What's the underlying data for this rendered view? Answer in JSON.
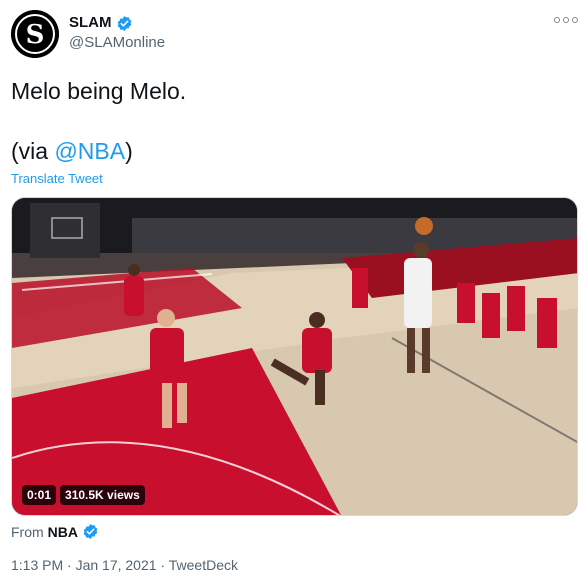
{
  "author": {
    "name": "SLAM",
    "handle": "@SLAMonline",
    "avatar_letter": "S",
    "verified_icon": "verified-badge-icon"
  },
  "tweet": {
    "line1": "Melo being Melo.",
    "line2_prefix": "(via ",
    "line2_mention": "@NBA",
    "line2_suffix": ")",
    "translate_label": "Translate Tweet"
  },
  "video": {
    "time": "0:01",
    "views": "310.5K views"
  },
  "source": {
    "from_label": "From",
    "name": "NBA"
  },
  "meta": {
    "timestamp": "1:13 PM · Jan 17, 2021 · TweetDeck"
  },
  "colors": {
    "link": "#1d9bf0",
    "secondary_text": "#536471"
  }
}
